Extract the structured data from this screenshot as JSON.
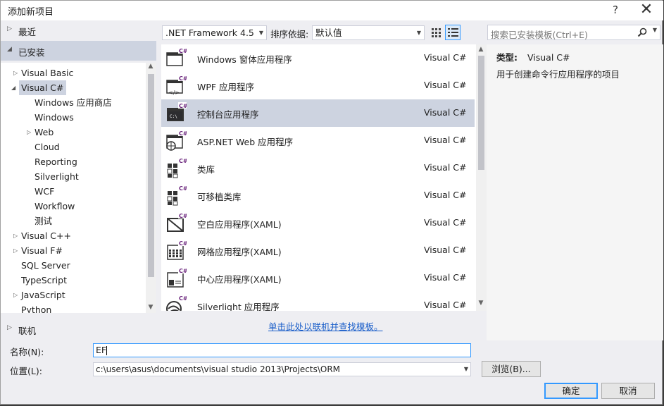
{
  "window": {
    "title": "添加新项目",
    "help": "?",
    "close": "✕"
  },
  "left": {
    "recent": "最近",
    "installed": "已安装",
    "online": "联机",
    "tree": [
      {
        "label": "Visual Basic",
        "indent": 0,
        "arrow": "collapsed"
      },
      {
        "label": "Visual C#",
        "indent": 0,
        "arrow": "expanded",
        "selected": true
      },
      {
        "label": "Windows 应用商店",
        "indent": 1
      },
      {
        "label": "Windows",
        "indent": 1
      },
      {
        "label": "Web",
        "indent": 1,
        "arrow": "collapsed"
      },
      {
        "label": "Cloud",
        "indent": 1
      },
      {
        "label": "Reporting",
        "indent": 1
      },
      {
        "label": "Silverlight",
        "indent": 1
      },
      {
        "label": "WCF",
        "indent": 1
      },
      {
        "label": "Workflow",
        "indent": 1
      },
      {
        "label": "测试",
        "indent": 1
      },
      {
        "label": "Visual C++",
        "indent": 0,
        "arrow": "collapsed"
      },
      {
        "label": "Visual F#",
        "indent": 0,
        "arrow": "collapsed"
      },
      {
        "label": "SQL Server",
        "indent": 0
      },
      {
        "label": "TypeScript",
        "indent": 0
      },
      {
        "label": "JavaScript",
        "indent": 0,
        "arrow": "collapsed"
      },
      {
        "label": "Python",
        "indent": 0
      }
    ]
  },
  "toolbar": {
    "framework": ".NET Framework 4.5",
    "sort_label": "排序依据:",
    "sort_value": "默认值"
  },
  "templates": [
    {
      "name": "Windows 窗体应用程序",
      "lang": "Visual C#",
      "icon": "windows-forms"
    },
    {
      "name": "WPF 应用程序",
      "lang": "Visual C#",
      "icon": "wpf"
    },
    {
      "name": "控制台应用程序",
      "lang": "Visual C#",
      "icon": "console",
      "selected": true
    },
    {
      "name": "ASP.NET Web 应用程序",
      "lang": "Visual C#",
      "icon": "web"
    },
    {
      "name": "类库",
      "lang": "Visual C#",
      "icon": "class-library"
    },
    {
      "name": "可移植类库",
      "lang": "Visual C#",
      "icon": "portable-library"
    },
    {
      "name": "空白应用程序(XAML)",
      "lang": "Visual C#",
      "icon": "blank-app"
    },
    {
      "name": "网格应用程序(XAML)",
      "lang": "Visual C#",
      "icon": "grid-app"
    },
    {
      "name": "中心应用程序(XAML)",
      "lang": "Visual C#",
      "icon": "hub-app"
    },
    {
      "name": "Silverlight 应用程序",
      "lang": "Visual C#",
      "icon": "silverlight"
    }
  ],
  "online_link": "单击此处以联机并查找模板。",
  "search": {
    "placeholder": "搜索已安装模板(Ctrl+E)"
  },
  "details": {
    "type_label": "类型:",
    "type_value": "Visual C#",
    "description": "用于创建命令行应用程序的项目"
  },
  "form": {
    "name_label": "名称(N):",
    "name_value": "EF",
    "location_label": "位置(L):",
    "location_value": "c:\\users\\asus\\documents\\visual studio 2013\\Projects\\ORM",
    "browse": "浏览(B)...",
    "ok": "确定",
    "cancel": "取消"
  },
  "colors": {
    "selection": "#cdd3e0",
    "link": "#1a5ec9",
    "focus_border": "#3399ff",
    "csharp_badge": "#68217a"
  }
}
